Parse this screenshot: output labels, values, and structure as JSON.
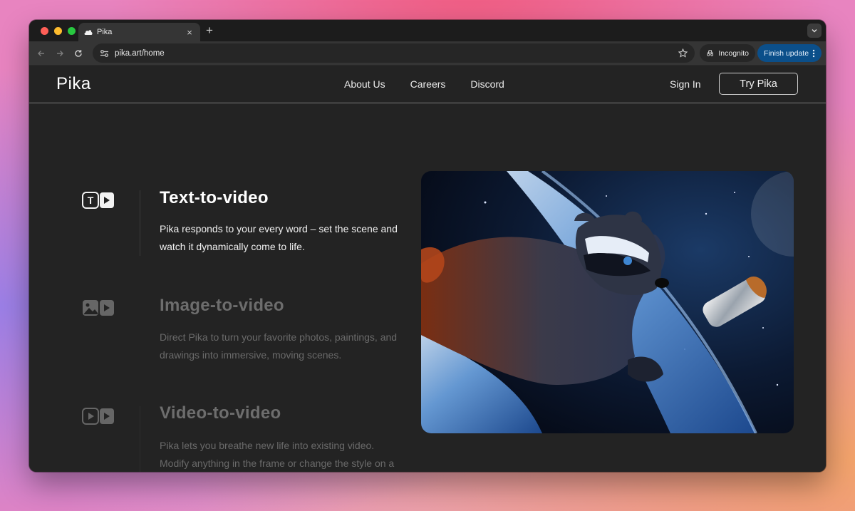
{
  "browser": {
    "tab_title": "Pika",
    "new_tab_symbol": "+",
    "close_symbol": "×",
    "url": "pika.art/home",
    "incognito_label": "Incognito",
    "update_label": "Finish update",
    "traffic_light_colors": [
      "#ff5f57",
      "#febc2e",
      "#28c840"
    ]
  },
  "nav": {
    "logo": "Pika",
    "links": [
      "About Us",
      "Careers",
      "Discord"
    ],
    "sign_in": "Sign In",
    "try_button": "Try Pika"
  },
  "features": [
    {
      "icon": "text-to-video-icon",
      "title": "Text-to-video",
      "description": "Pika responds to your every word – set the scene and watch it dynamically come to life.",
      "active": true
    },
    {
      "icon": "image-to-video-icon",
      "title": "Image-to-video",
      "description": "Direct Pika to turn your favorite photos, paintings, and drawings into immersive, moving scenes.",
      "active": false
    },
    {
      "icon": "video-to-video-icon",
      "title": "Video-to-video",
      "description": "Pika lets you breathe new life into existing video. Modify anything in the frame or change the style on a whim.",
      "active": false
    }
  ],
  "hero_image": "raccoon floating in space next to a foil-wrapped burrito above Earth"
}
